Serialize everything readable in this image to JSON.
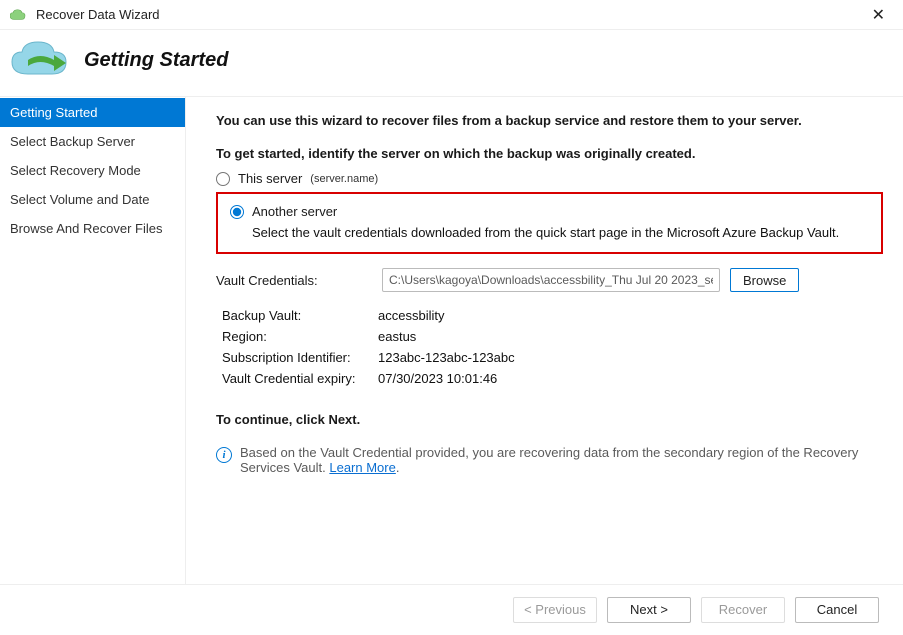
{
  "window": {
    "title": "Recover Data Wizard"
  },
  "header": {
    "title": "Getting Started"
  },
  "sidebar": {
    "steps": [
      {
        "label": "Getting Started",
        "active": true
      },
      {
        "label": "Select Backup Server",
        "active": false
      },
      {
        "label": "Select Recovery Mode",
        "active": false
      },
      {
        "label": "Select Volume and Date",
        "active": false
      },
      {
        "label": "Browse And Recover Files",
        "active": false
      }
    ]
  },
  "content": {
    "intro": "You can use this wizard to recover files from a backup service and restore them to your server.",
    "identify_line": "To get started, identify the server on which the backup was originally created.",
    "this_server_label": "This server",
    "this_server_name": "(server.name)",
    "another_server_label": "Another server",
    "another_server_desc": "Select the vault credentials downloaded from the quick start page in the Microsoft Azure Backup Vault.",
    "vault_credentials_label": "Vault Credentials:",
    "vault_credentials_path": "C:\\Users\\kagoya\\Downloads\\accessbility_Thu Jul 20 2023_se",
    "browse_label": "Browse",
    "details": {
      "backup_vault_label": "Backup Vault:",
      "backup_vault_value": "accessbility",
      "region_label": "Region:",
      "region_value": "eastus",
      "subscription_label": "Subscription Identifier:",
      "subscription_value": "123abc-123abc-123abc",
      "expiry_label": "Vault Credential expiry:",
      "expiry_value": "07/30/2023 10:01:46"
    },
    "continue_line": "To continue, click Next.",
    "info_text_prefix": "Based on the Vault Credential provided, you are recovering data from the secondary region of the Recovery Services Vault. ",
    "learn_more": "Learn More"
  },
  "footer": {
    "previous": "< Previous",
    "next": "Next >",
    "recover": "Recover",
    "cancel": "Cancel"
  }
}
